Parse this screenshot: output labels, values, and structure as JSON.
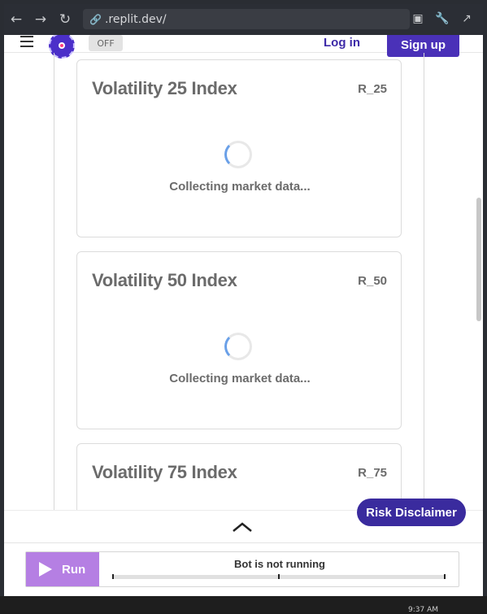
{
  "browser": {
    "url": ".replit.dev/",
    "back_icon": "back-arrow-icon",
    "forward_icon": "forward-arrow-icon",
    "reload_icon": "reload-icon"
  },
  "header": {
    "toggle_label": "OFF",
    "login_label": "Log in",
    "signup_label": "Sign up"
  },
  "cards": [
    {
      "title": "Volatility 25 Index",
      "code": "R_25",
      "status": "Collecting market data..."
    },
    {
      "title": "Volatility 50 Index",
      "code": "R_50",
      "status": "Collecting market data..."
    },
    {
      "title": "Volatility 75 Index",
      "code": "R_75"
    }
  ],
  "risk_disclaimer_label": "Risk Disclaimer",
  "runbar": {
    "run_label": "Run",
    "status_text": "Bot is not running"
  },
  "clock_text": "9:37 AM",
  "colors": {
    "accent": "#4a31b8",
    "run": "#b57fe3",
    "risk": "#3a2b9e"
  }
}
